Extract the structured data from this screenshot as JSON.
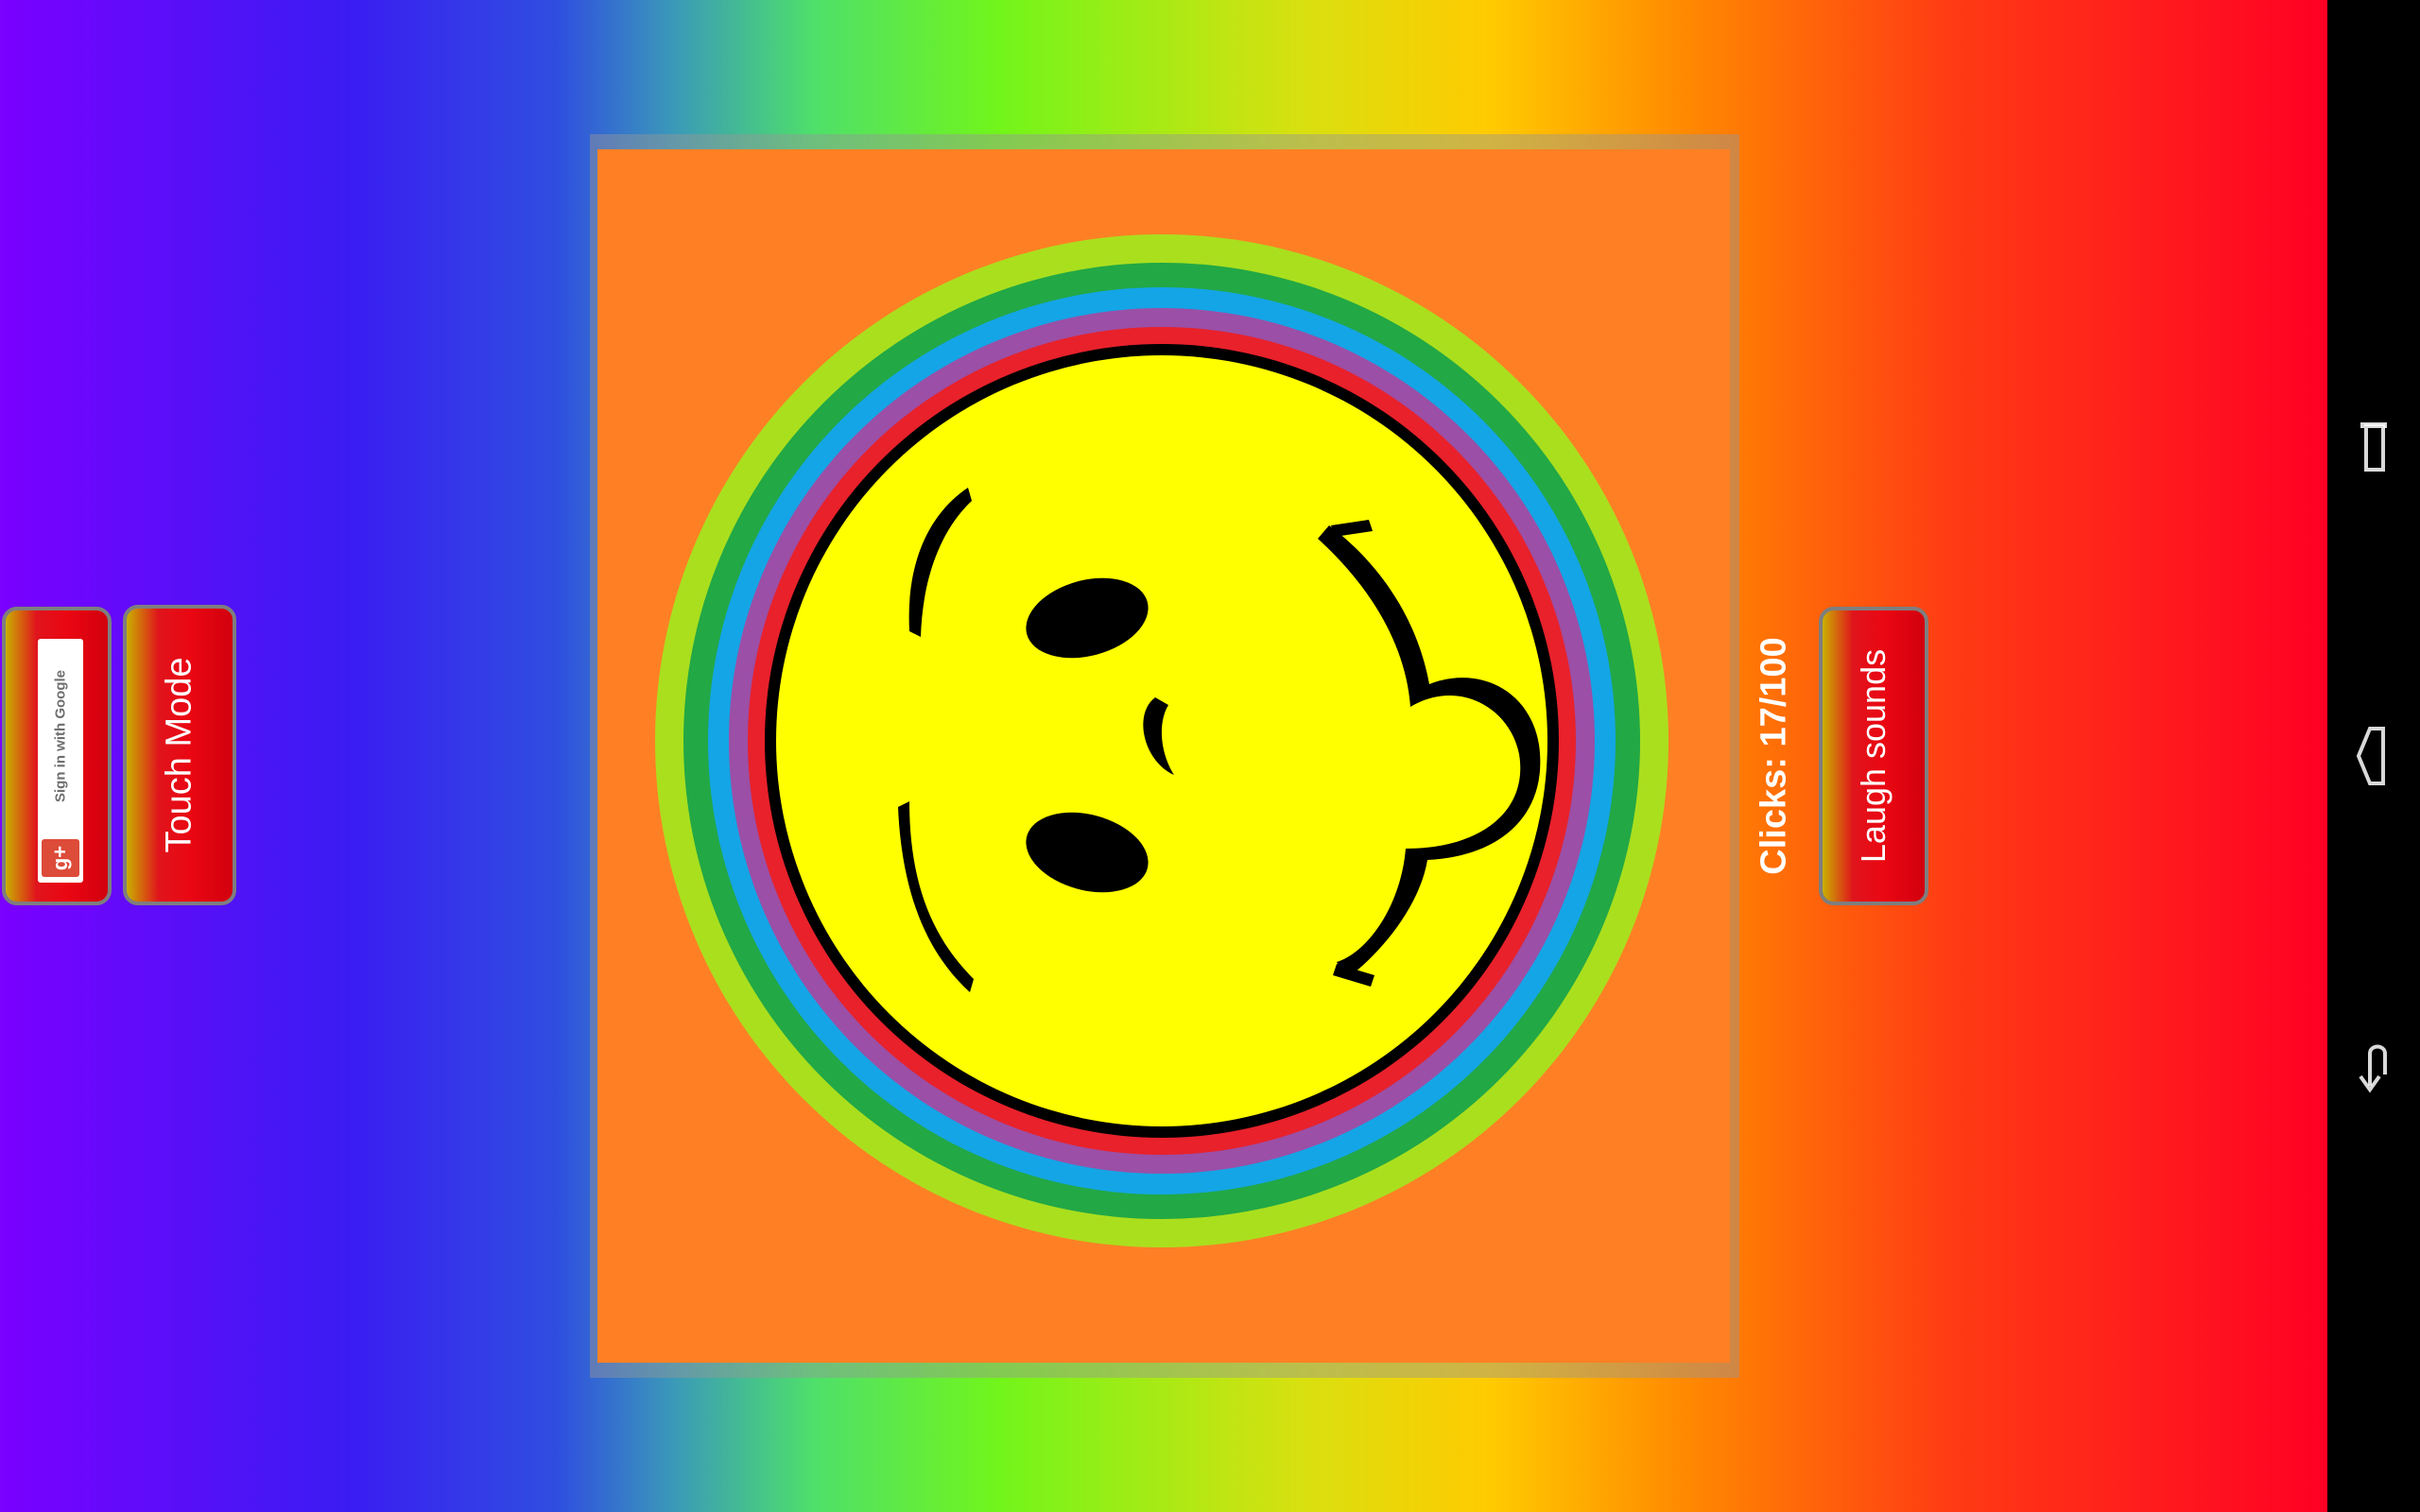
{
  "left_controls": {
    "google_signin_label": "Sign in with Google",
    "google_plus_glyph": "g+",
    "touch_mode_label": "Touch Mode"
  },
  "game": {
    "clicks_text": "Clicks: 17/100",
    "laugh_sounds_label": "Laugh sounds",
    "smiley_face_icon": "laughing-smiley-icon"
  },
  "navbar": {
    "icons": [
      "recent-apps-icon",
      "home-icon",
      "back-icon"
    ]
  },
  "colors": {
    "canvas_bg": "#ff8024",
    "face_yellow": "#ffff00",
    "button_red": "#e0141c",
    "ring_colors": [
      "#aadf1e",
      "#22a845",
      "#14a5e6",
      "#9b4fa6",
      "#e8212b"
    ]
  }
}
